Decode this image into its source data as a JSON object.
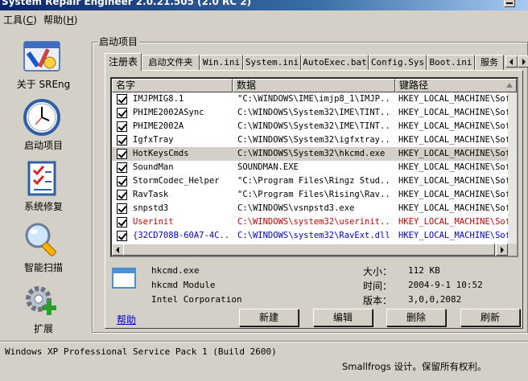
{
  "window": {
    "title": "System Repair Engineer 2.0.21.505 (2.0 RC 2)"
  },
  "menu": [
    {
      "label": "工具(",
      "key": "C",
      "end": ")"
    },
    {
      "label": "帮助(",
      "key": "H",
      "end": ")"
    }
  ],
  "nav": [
    {
      "label": "关于 SREng",
      "icon": "about-tools-icon"
    },
    {
      "label": "启动项目",
      "icon": "clock-icon"
    },
    {
      "label": "系统修复",
      "icon": "checklist-icon"
    },
    {
      "label": "智能扫描",
      "icon": "magnifier-icon"
    },
    {
      "label": "扩展",
      "icon": "gear-plus-icon"
    }
  ],
  "group_title": "启动项目",
  "tabs": [
    "注册表",
    "启动文件夹",
    "Win.ini",
    "System.ini",
    "AutoExec.bat",
    "Config.Sys",
    "Boot.ini",
    "服务"
  ],
  "list": {
    "columns": [
      "名字",
      "数据",
      "键路径"
    ],
    "rows": [
      {
        "name": "IMJPMIG8.1",
        "data": "\"C:\\WINDOWS\\IME\\imjp8_1\\IMJP...",
        "key": "HKEY_LOCAL_MACHINE\\Sof",
        "color": "#000000"
      },
      {
        "name": "PHIME2002ASync",
        "data": "C:\\WINDOWS\\System32\\IME\\TINT...",
        "key": "HKEY_LOCAL_MACHINE\\Sof",
        "color": "#000000"
      },
      {
        "name": "PHIME2002A",
        "data": "C:\\WINDOWS\\System32\\IME\\TINT...",
        "key": "HKEY_LOCAL_MACHINE\\Sof",
        "color": "#000000"
      },
      {
        "name": "IgfxTray",
        "data": "C:\\WINDOWS\\System32\\igfxtray...",
        "key": "HKEY_LOCAL_MACHINE\\Sof",
        "color": "#000000"
      },
      {
        "name": "HotKeysCmds",
        "data": "C:\\WINDOWS\\System32\\hkcmd.exe",
        "key": "HKEY_LOCAL_MACHINE\\Sof",
        "color": "#000000",
        "selected": true
      },
      {
        "name": "SoundMan",
        "data": "SOUNDMAN.EXE",
        "key": "HKEY_LOCAL_MACHINE\\Sof",
        "color": "#000000"
      },
      {
        "name": "StormCodec_Helper",
        "data": "\"C:\\Program Files\\Ringz Stud...",
        "key": "HKEY_LOCAL_MACHINE\\Sof",
        "color": "#000000"
      },
      {
        "name": "RavTask",
        "data": "\"C:\\Program Files\\Rising\\Rav...",
        "key": "HKEY_LOCAL_MACHINE\\Sof",
        "color": "#000000"
      },
      {
        "name": "snpstd3",
        "data": "C:\\WINDOWS\\vsnpstd3.exe",
        "key": "HKEY_LOCAL_MACHINE\\Sof",
        "color": "#000000"
      },
      {
        "name": "Userinit",
        "data": "C:\\WINDOWS\\system32\\userinit...",
        "key": "HKEY_LOCAL_MACHINE\\Sof",
        "color": "#cc0000"
      },
      {
        "name": "{32CD708B-60A7-4C...",
        "data": "C:\\WINDOWS\\system32\\RavExt.dll",
        "key": "HKEY_LOCAL_MACHINE\\Sof",
        "color": "#0000cc"
      }
    ]
  },
  "details": {
    "file": "hkcmd.exe",
    "description": "hkcmd Module",
    "company": "Intel Corporation",
    "size_label": "大小：",
    "size_value": "112 KB",
    "time_label": "时间：",
    "time_value": "2004-9-1 10:52",
    "version_label": "版本：",
    "version_value": "3,0,0,2082"
  },
  "help_link": "帮助",
  "buttons": {
    "new": "新建",
    "edit": "编辑",
    "delete": "删除",
    "refresh": "刷新"
  },
  "status": {
    "os": "Windows XP Professional Service Pack 1 (Build 2600)",
    "copyright": "Smallfrogs 设计。保留所有权利。"
  }
}
